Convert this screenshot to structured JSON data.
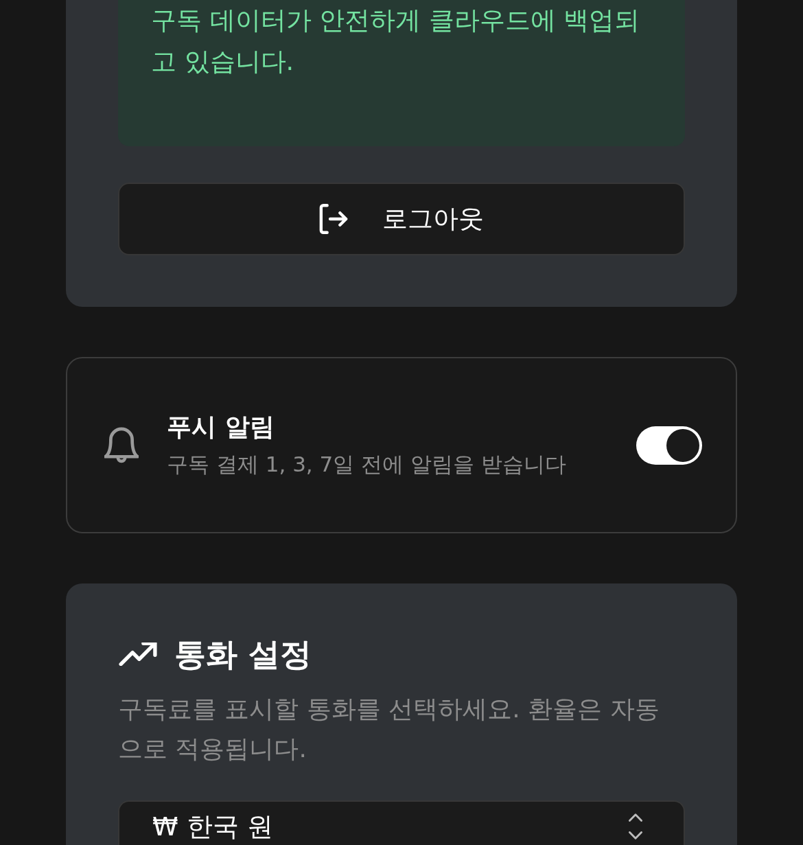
{
  "backup_card": {
    "message": "구독 데이터가 안전하게 클라우드에 백업되고 있습니다.",
    "logout_button": "로그아웃"
  },
  "push_notifications": {
    "title": "푸시 알림",
    "description": "구독 결제 1, 3, 7일 전에 알림을 받습니다",
    "on": true
  },
  "currency_settings": {
    "title": "통화 설정",
    "description": "구독료를 표시할 통화를 선택하세요. 환율은 자동으로 적용됩니다.",
    "select": {
      "value": "₩ 한국 원"
    }
  }
}
